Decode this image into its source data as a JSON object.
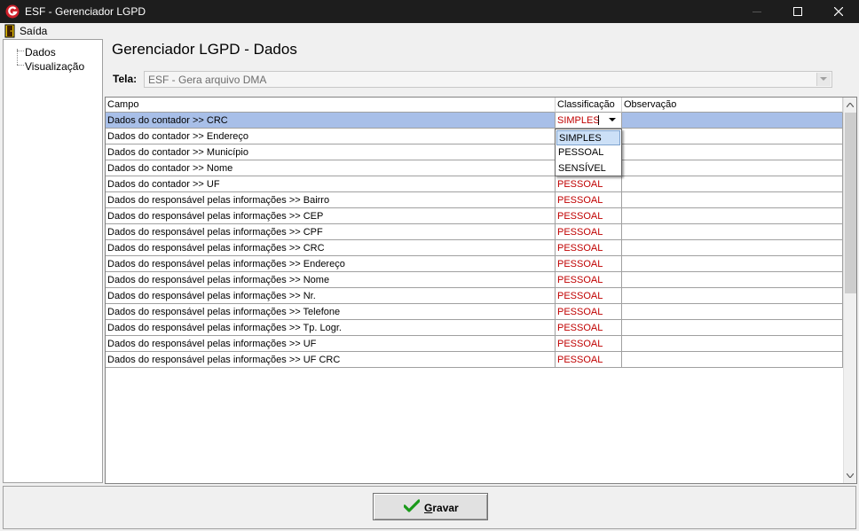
{
  "window": {
    "title": "ESF - Gerenciador LGPD",
    "icon": "esf-logo-icon"
  },
  "menu": {
    "exit_label": "Saída"
  },
  "tree": {
    "items": [
      {
        "label": "Dados"
      },
      {
        "label": "Visualização"
      }
    ]
  },
  "page": {
    "title": "Gerenciador LGPD - Dados"
  },
  "tela": {
    "label": "Tela:",
    "value": "ESF - Gera arquivo DMA"
  },
  "grid": {
    "columns": {
      "campo": "Campo",
      "classificacao": "Classificação",
      "observacao": "Observação"
    },
    "rows": [
      {
        "campo": "Dados do contador >> CRC",
        "classificacao": "SIMPLES",
        "observacao": ""
      },
      {
        "campo": "Dados do contador >> Endereço",
        "classificacao": "",
        "observacao": ""
      },
      {
        "campo": "Dados do contador >> Município",
        "classificacao": "",
        "observacao": ""
      },
      {
        "campo": "Dados do contador >> Nome",
        "classificacao": "",
        "observacao": ""
      },
      {
        "campo": "Dados do contador >> UF",
        "classificacao": "PESSOAL",
        "observacao": ""
      },
      {
        "campo": "Dados do responsável pelas informações >> Bairro",
        "classificacao": "PESSOAL",
        "observacao": ""
      },
      {
        "campo": "Dados do responsável pelas informações >> CEP",
        "classificacao": "PESSOAL",
        "observacao": ""
      },
      {
        "campo": "Dados do responsável pelas informações >> CPF",
        "classificacao": "PESSOAL",
        "observacao": ""
      },
      {
        "campo": "Dados do responsável pelas informações >> CRC",
        "classificacao": "PESSOAL",
        "observacao": ""
      },
      {
        "campo": "Dados do responsável pelas informações >> Endereço",
        "classificacao": "PESSOAL",
        "observacao": ""
      },
      {
        "campo": "Dados do responsável pelas informações >> Nome",
        "classificacao": "PESSOAL",
        "observacao": ""
      },
      {
        "campo": "Dados do responsável pelas informações >> Nr.",
        "classificacao": "PESSOAL",
        "observacao": ""
      },
      {
        "campo": "Dados do responsável pelas informações >> Telefone",
        "classificacao": "PESSOAL",
        "observacao": ""
      },
      {
        "campo": "Dados do responsável pelas informações >> Tp. Logr.",
        "classificacao": "PESSOAL",
        "observacao": ""
      },
      {
        "campo": "Dados do responsável pelas informações >> UF",
        "classificacao": "PESSOAL",
        "observacao": ""
      },
      {
        "campo": "Dados do responsável pelas informações >> UF CRC",
        "classificacao": "PESSOAL",
        "observacao": ""
      }
    ],
    "dropdown_options": [
      "SIMPLES",
      "PESSOAL",
      "SENSÍVEL"
    ],
    "dropdown_highlighted": "SIMPLES"
  },
  "buttons": {
    "save_label": "Gravar"
  },
  "colors": {
    "classification_text": "#c00000",
    "selected_row": "#a8bfe8",
    "titlebar": "#1d1d1d"
  }
}
